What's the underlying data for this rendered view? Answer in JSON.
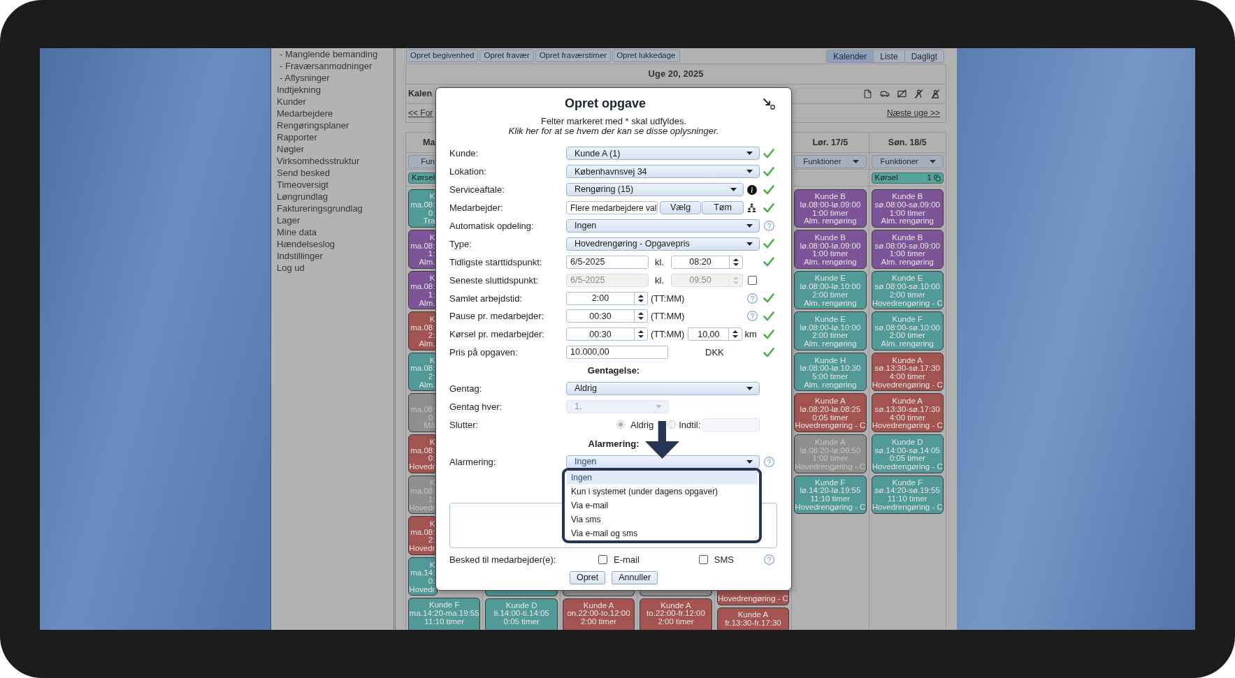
{
  "sidebar": {
    "items": [
      {
        "label": "- Manglende bemanding",
        "kind": "sub"
      },
      {
        "label": "- Fraværsanmodninger",
        "kind": "sub"
      },
      {
        "label": "- Aflysninger",
        "kind": "sub"
      },
      {
        "label": "Indtjekning",
        "kind": "main"
      },
      {
        "label": "Kunder",
        "kind": "main"
      },
      {
        "label": "Medarbejdere",
        "kind": "main"
      },
      {
        "label": "Rengøringsplaner",
        "kind": "main"
      },
      {
        "label": "Rapporter",
        "kind": "main"
      },
      {
        "label": "Nøgler",
        "kind": "main"
      },
      {
        "label": "Virksomhedsstruktur",
        "kind": "main"
      },
      {
        "label": "Send besked",
        "kind": "main"
      },
      {
        "label": "Timeoversigt",
        "kind": "main"
      },
      {
        "label": "Løngrundlag",
        "kind": "main"
      },
      {
        "label": "Faktureringsgrundlag",
        "kind": "main"
      },
      {
        "label": "Lager",
        "kind": "main"
      },
      {
        "label": "Mine data",
        "kind": "main"
      },
      {
        "label": "Hændelseslog",
        "kind": "main"
      },
      {
        "label": "Indstillinger",
        "kind": "main"
      },
      {
        "label": "Log ud",
        "kind": "main"
      }
    ]
  },
  "toolbar": {
    "actions": [
      "Opret begivenhed",
      "Opret fravær",
      "Opret fraværstimer",
      "Opret lukkedage"
    ],
    "views": [
      {
        "label": "Kalender",
        "selected": true
      },
      {
        "label": "Liste",
        "selected": false
      },
      {
        "label": "Dagligt",
        "selected": false
      }
    ]
  },
  "calendar": {
    "week_title": "Uge 20, 2025",
    "heading": "Kalen",
    "prev_link": "<< For",
    "next_link": "Næste uge >>",
    "days": [
      {
        "label": "Ma",
        "functions": "Fun",
        "korsel": {
          "label": "Kørsel"
        },
        "events": [
          {
            "lines": [
              "K",
              "ma.08:",
              "0:",
              "Tra"
            ],
            "color": "#519a98",
            "disabled": false
          },
          {
            "lines": [
              "K",
              "ma.08:",
              "1:",
              "Alm."
            ],
            "color": "#7d5497",
            "disabled": false
          },
          {
            "lines": [
              "K",
              "ma.08:",
              "1:",
              "Alm."
            ],
            "color": "#7d5497",
            "disabled": false
          },
          {
            "lines": [
              "K",
              "ma.08:",
              "2:",
              "Alm."
            ],
            "color": "#a35451",
            "disabled": false
          },
          {
            "lines": [
              "K",
              "ma.08:",
              "2:",
              "Alm."
            ],
            "color": "#519a98",
            "disabled": false
          },
          {
            "lines": [
              "ma.08:",
              "0:",
              "Må"
            ],
            "color": "#8f8f8f",
            "disabled": true
          },
          {
            "lines": [
              "K",
              "ma.08:",
              "0:",
              "Hovedr"
            ],
            "color": "#a35451",
            "disabled": false
          },
          {
            "lines": [
              "K",
              "ma.08:",
              "1:",
              "Hovedr"
            ],
            "color": "#8f8f8f",
            "disabled": true
          },
          {
            "lines": [
              "K",
              "ma.08:",
              "2:",
              "Hovedr"
            ],
            "color": "#a35451",
            "disabled": false
          },
          {
            "lines": [
              "K",
              "ma.14:",
              "0:",
              "Hovedr"
            ],
            "color": "#519a98",
            "disabled": false
          },
          {
            "lines": [
              "Kunde F",
              "ma.14:20-ma.19:55",
              "11:10 timer"
            ],
            "color": "#519a98",
            "disabled": false
          }
        ]
      },
      {
        "events": [
          {
            "color": "#519a98"
          },
          {
            "lines": [
              "Kunde D",
              "ti.14:00-ti.14:05",
              "0:05 timer"
            ],
            "color": "#519a98",
            "disabled": false
          }
        ]
      },
      {
        "events": [
          {
            "color": "#8f8f8f"
          },
          {
            "lines": [
              "Kunde A",
              "on.22:00-to.12:00",
              "2:00 timer"
            ],
            "color": "#a35451",
            "disabled": false
          }
        ]
      },
      {
        "events": [
          {
            "color": "#8f8f8f"
          },
          {
            "lines": [
              "Kunde A",
              "to.22:00-fr.12:00",
              "2:00 timer"
            ],
            "color": "#a35451",
            "disabled": false
          }
        ]
      },
      {
        "events": [
          {
            "lines": [
              "Hovedrengøring - C"
            ],
            "color": "#a35451",
            "disabled": false
          },
          {
            "lines": [
              "Kunde A",
              "fr.13:30-fr.17:30"
            ],
            "color": "#a35451",
            "disabled": false
          }
        ]
      },
      {
        "label": "Lør. 17/5",
        "functions": "Funktioner",
        "events": [
          {
            "lines": [
              "Kunde B",
              "lø.08:00-lø.09:00",
              "1:00 timer",
              "Alm. rengøring"
            ],
            "color": "#7d5497",
            "disabled": false
          },
          {
            "lines": [
              "Kunde B",
              "lø.08:00-lø.09:00",
              "1:00 timer",
              "Alm. rengøring"
            ],
            "color": "#7d5497",
            "disabled": false
          },
          {
            "lines": [
              "Kunde E",
              "lø.08:00-lø.10:00",
              "2:00 timer",
              "Alm. rengøring"
            ],
            "color": "#519a98",
            "disabled": false
          },
          {
            "lines": [
              "Kunde E",
              "lø.08:00-lø.10:00",
              "2:00 timer",
              "Alm. rengøring"
            ],
            "color": "#519a98",
            "disabled": false
          },
          {
            "lines": [
              "Kunde H",
              "lø.08:00-lø.10:30",
              "5:00 timer",
              "Alm. rengøring"
            ],
            "color": "#519a98",
            "disabled": false
          },
          {
            "lines": [
              "Kunde A",
              "lø.08:20-lø.08:25",
              "0:05 timer",
              "Hovedrengøring - C"
            ],
            "color": "#a35451",
            "disabled": false
          },
          {
            "lines": [
              "Kunde A",
              "lø.08:20-lø.09:50",
              "1:00 timer",
              "Hovedrengøring - C"
            ],
            "color": "#8f8f8f",
            "disabled": true
          },
          {
            "lines": [
              "Kunde F",
              "lø.14:20-lø.19:55",
              "11:10 timer",
              "Hovedrengøring - C"
            ],
            "color": "#519a98",
            "disabled": false
          }
        ]
      },
      {
        "label": "Søn. 18/5",
        "functions": "Funktioner",
        "korsel": {
          "label": "Kørsel",
          "count": "1"
        },
        "events": [
          {
            "lines": [
              "Kunde B",
              "sø.08:00-sø.09:00",
              "1:00 timer",
              "Alm. rengøring"
            ],
            "color": "#7d5497",
            "disabled": false
          },
          {
            "lines": [
              "Kunde B",
              "sø.08:00-sø.09:00",
              "1:00 timer",
              "Alm. rengøring"
            ],
            "color": "#7d5497",
            "disabled": false
          },
          {
            "lines": [
              "Kunde E",
              "sø.08:00-sø.10:00",
              "2:00 timer",
              "Hovedrengøring - C"
            ],
            "color": "#519a98",
            "disabled": false
          },
          {
            "lines": [
              "Kunde F",
              "sø.08:00-sø.10:00",
              "2:00 timer",
              "Alm. rengøring"
            ],
            "color": "#519a98",
            "disabled": false
          },
          {
            "lines": [
              "Kunde A",
              "sø.13:30-sø.17:30",
              "4:00 timer",
              "Hovedrengøring - C"
            ],
            "color": "#a35451",
            "disabled": false
          },
          {
            "lines": [
              "Kunde A",
              "sø.13:30-sø.17:30",
              "4:00 timer",
              "Hovedrengøring - C"
            ],
            "color": "#a35451",
            "disabled": false
          },
          {
            "lines": [
              "Kunde D",
              "sø.14:00-sø.14:05",
              "0:05 timer",
              "Hovedrengøring - C"
            ],
            "color": "#519a98",
            "disabled": false
          },
          {
            "lines": [
              "Kunde F",
              "sø.14:20-sø.19:55",
              "11:10 timer",
              "Hovedrengøring - C"
            ],
            "color": "#519a98",
            "disabled": false
          }
        ]
      }
    ]
  },
  "dialog": {
    "title": "Opret opgave",
    "note": "Felter markeret med * skal udfyldes.",
    "info_link": "Klik her for at se hvem der kan se disse oplysninger.",
    "fields": [
      {
        "kind": "select",
        "label": "Kunde:",
        "value": "Kunde A (1)",
        "valid": true
      },
      {
        "kind": "select",
        "label": "Lokation:",
        "value": "Københavnsvej 34",
        "valid": true
      },
      {
        "kind": "select",
        "label": "Serviceaftale:",
        "value": "Rengøring (15)",
        "info": true,
        "valid": true
      },
      {
        "kind": "employees",
        "label": "Medarbejder:",
        "value": "Flere medarbejdere val",
        "buttons": [
          "Vælg",
          "Tøm"
        ],
        "valid": true
      },
      {
        "kind": "select",
        "label": "Automatisk opdeling:",
        "value": "Ingen",
        "help": true
      },
      {
        "kind": "select",
        "label": "Type:",
        "value": "Hovedrengøring - Opgavepris",
        "valid": true
      },
      {
        "kind": "datetime",
        "label": "Tidligste starttidspunkt:",
        "date": "6/5-2025",
        "time_label": "kl.",
        "time": "08:20",
        "valid": true
      },
      {
        "kind": "datetime",
        "label": "Seneste sluttidspunkt:",
        "date": "6/5-2025",
        "time_label": "kl.",
        "time": "09:50",
        "disabled": true,
        "checkbox": {
          "checked": false
        }
      },
      {
        "kind": "duration",
        "label": "Samlet arbejdstid:",
        "value": "2:00",
        "unit": "(TT:MM)",
        "help": true,
        "valid": true
      },
      {
        "kind": "duration",
        "label": "Pause pr. medarbejder:",
        "value": "00:30",
        "unit": "(TT:MM)",
        "help": true,
        "valid": true
      },
      {
        "kind": "distance",
        "label": "Kørsel pr. medarbejder:",
        "value": "00:30",
        "unit": "(TT:MM)",
        "distance": "10,00",
        "distance_unit": "km",
        "valid": true
      },
      {
        "kind": "price",
        "label": "Pris på opgaven:",
        "value": "10.000,00",
        "currency": "DKK",
        "valid": true
      }
    ],
    "recurrence": {
      "heading": "Gentagelse:",
      "repeat": {
        "label": "Gentag:",
        "value": "Aldrig"
      },
      "interval": {
        "label": "Gentag hver:",
        "value": "1.",
        "disabled": true
      },
      "ends": {
        "label": "Slutter:",
        "disabled": true,
        "options": [
          {
            "label": "Aldrig",
            "selected": true
          },
          {
            "label": "Indtil:",
            "selected": false
          }
        ]
      }
    },
    "alarm": {
      "heading": "Alarmering:",
      "label": "Alarmering:",
      "value": "Ingen",
      "help": true,
      "expanded": true,
      "options": [
        {
          "label": "Ingen",
          "selected": true
        },
        {
          "label": "Kun i systemet (under dagens opgaver)",
          "selected": false
        },
        {
          "label": "Via e-mail",
          "selected": false
        },
        {
          "label": "Via sms",
          "selected": false
        },
        {
          "label": "Via e-mail og sms",
          "selected": false
        }
      ]
    },
    "message": {
      "label": "Besked til medarbejder(e):",
      "options": [
        {
          "label": "E-mail",
          "checked": false
        },
        {
          "label": "SMS",
          "checked": false
        }
      ],
      "help": true
    },
    "buttons": [
      "Opret",
      "Annuller"
    ]
  }
}
